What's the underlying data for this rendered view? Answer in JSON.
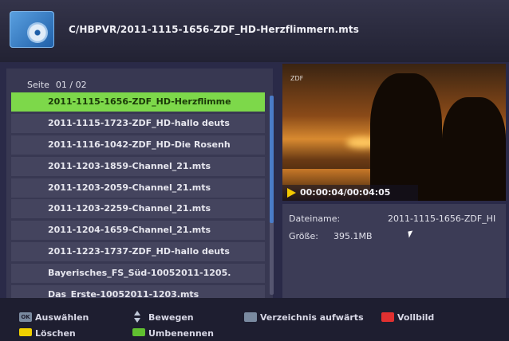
{
  "header": {
    "path": "C/HBPVR/2011-1115-1656-ZDF_HD-Herzflimmern.mts"
  },
  "list": {
    "page_label": "Seite",
    "page_value": "01 / 02",
    "selected_index": 0,
    "items": [
      "2011-1115-1656-ZDF_HD-Herzflimme",
      "2011-1115-1723-ZDF_HD-hallo deuts",
      "2011-1116-1042-ZDF_HD-Die Rosenh",
      "2011-1203-1859-Channel_21.mts",
      "2011-1203-2059-Channel_21.mts",
      "2011-1203-2259-Channel_21.mts",
      "2011-1204-1659-Channel_21.mts",
      "2011-1223-1737-ZDF_HD-hallo deuts",
      "Bayerisches_FS_Süd-10052011-1205.",
      "Das_Erste-10052011-1203.mts"
    ]
  },
  "preview": {
    "channel_logo": "ZDF",
    "time": "00:00:04/00:04:05"
  },
  "info": {
    "filename_label": "Dateiname:",
    "filename_value": "2011-1115-1656-ZDF_HI",
    "size_label": "Größe:",
    "size_value": "395.1MB"
  },
  "footer": {
    "select": "Auswählen",
    "move": "Bewegen",
    "dir_up": "Verzeichnis aufwärts",
    "fullscreen": "Vollbild",
    "delete": "Löschen",
    "rename": "Umbenennen",
    "ok_key": "OK"
  },
  "colors": {
    "selected_row": "#7dd84a",
    "red_key": "#e03030",
    "yellow_key": "#f0d000",
    "green_key": "#60c030"
  }
}
